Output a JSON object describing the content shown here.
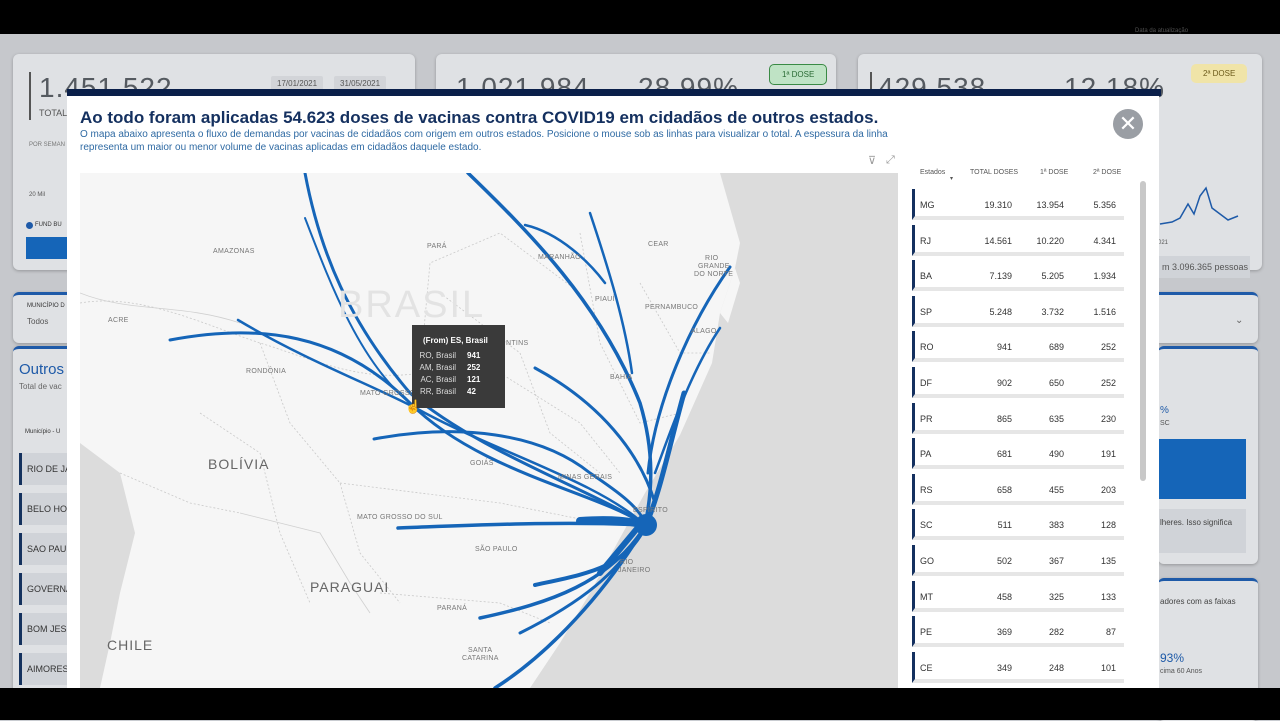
{
  "background": {
    "kpis": [
      {
        "value": "1.451.522",
        "label": "TOTAL"
      },
      {
        "value": "1.021.984",
        "pct": "28,99%"
      },
      {
        "value": "429.538",
        "pct": "12,18%"
      }
    ],
    "date_start": "17/01/2021",
    "date_end": "31/05/2021",
    "badge_first": "1ª DOSE",
    "badge_second": "2ª DOSE",
    "per_week": "POR SEMAN",
    "legend_20mil": "20 Mil",
    "fund_bu": "FUND BU",
    "municipio_label": "MUNICÍPIO D",
    "municipio_value": "Todos",
    "outros_title": "Outros",
    "total_vac": "Total de vac",
    "municipio_col": "Município - U",
    "side_cities": [
      "RIO DE JA",
      "BELO HO",
      "SAO PAU",
      "GOVERNA",
      "BOM JES",
      "AIMORES"
    ],
    "right_pessoas": "m 3.096.365 pessoas",
    "right_pct": "%",
    "right_sc": "SC",
    "right_text1": "lheres. Isso significa",
    "right_text2": "adores com as faixas",
    "right_pct2": "93%",
    "right_60": "cima 60 Anos",
    "right_year": "021",
    "update_label": "Data da atualização"
  },
  "modal": {
    "title": "Ao todo foram aplicadas 54.623 doses de vacinas contra COVID19 em cidadãos de outros estados.",
    "description": "O mapa abaixo apresenta o fluxo de demandas por vacinas de cidadãos com origem em outros estados. Posicione o mouse sob as linhas para visualizar o total. A espessura da linha representa um maior ou menor volume de vacinas aplicadas em cidadãos daquele estado.",
    "close_icon": "close-icon",
    "filter_icon": "filter-icon",
    "focus_icon": "focus-mode-icon"
  },
  "map": {
    "labels": {
      "amazonas": "AMAZONAS",
      "para": "PARÁ",
      "acre": "ACRE",
      "rondonia": "RONDÔNIA",
      "maranhao": "MARANHÃO",
      "ceara": "CEAR",
      "rio_grande_norte_1": "RIO",
      "rio_grande_norte_2": "GRANDE",
      "rio_grande_norte_3": "DO NORTE",
      "piaui": "PIAUÍ",
      "pernambuco": "PERNAMBUCO",
      "alagoas": "ALAGO",
      "tocantins": "NTINS",
      "bahia": "BAHIA",
      "mato_grosso": "MATO GROSSO",
      "goias": "GOIÁS",
      "minas": "MINAS GERAIS",
      "espirito": "ESPÍRITO",
      "ms": "MATO GROSSO DO SUL",
      "sao_paulo": "SÃO PAULO",
      "rio_janeiro_1": "RIO",
      "rio_janeiro_2": "JANEIRO",
      "parana": "PARANÁ",
      "santa_catarina_1": "SANTA",
      "santa_catarina_2": "CATARINA",
      "brasil": "BRASIL",
      "bolivia": "BOLÍVIA",
      "paraguai": "PARAGUAI",
      "chile": "CHILE"
    },
    "flow_color": "#1565b8",
    "destination": "ES, Brasil"
  },
  "tooltip": {
    "title": "(From) ES, Brasil",
    "rows": [
      {
        "name": "RO, Brasil",
        "value": "941"
      },
      {
        "name": "AM, Brasil",
        "value": "252"
      },
      {
        "name": "AC, Brasil",
        "value": "121"
      },
      {
        "name": "RR, Brasil",
        "value": "42"
      }
    ]
  },
  "table": {
    "headers": {
      "estado": "Estados",
      "total": "TOTAL DOSES",
      "d1": "1ª DOSE",
      "d2": "2ª DOSE"
    },
    "rows": [
      {
        "estado": "MG",
        "total": "19.310",
        "d1": "13.954",
        "d2": "5.356"
      },
      {
        "estado": "RJ",
        "total": "14.561",
        "d1": "10.220",
        "d2": "4.341"
      },
      {
        "estado": "BA",
        "total": "7.139",
        "d1": "5.205",
        "d2": "1.934"
      },
      {
        "estado": "SP",
        "total": "5.248",
        "d1": "3.732",
        "d2": "1.516"
      },
      {
        "estado": "RO",
        "total": "941",
        "d1": "689",
        "d2": "252"
      },
      {
        "estado": "DF",
        "total": "902",
        "d1": "650",
        "d2": "252"
      },
      {
        "estado": "PR",
        "total": "865",
        "d1": "635",
        "d2": "230"
      },
      {
        "estado": "PA",
        "total": "681",
        "d1": "490",
        "d2": "191"
      },
      {
        "estado": "RS",
        "total": "658",
        "d1": "455",
        "d2": "203"
      },
      {
        "estado": "SC",
        "total": "511",
        "d1": "383",
        "d2": "128"
      },
      {
        "estado": "GO",
        "total": "502",
        "d1": "367",
        "d2": "135"
      },
      {
        "estado": "MT",
        "total": "458",
        "d1": "325",
        "d2": "133"
      },
      {
        "estado": "PE",
        "total": "369",
        "d1": "282",
        "d2": "87"
      },
      {
        "estado": "CE",
        "total": "349",
        "d1": "248",
        "d2": "101"
      }
    ]
  }
}
